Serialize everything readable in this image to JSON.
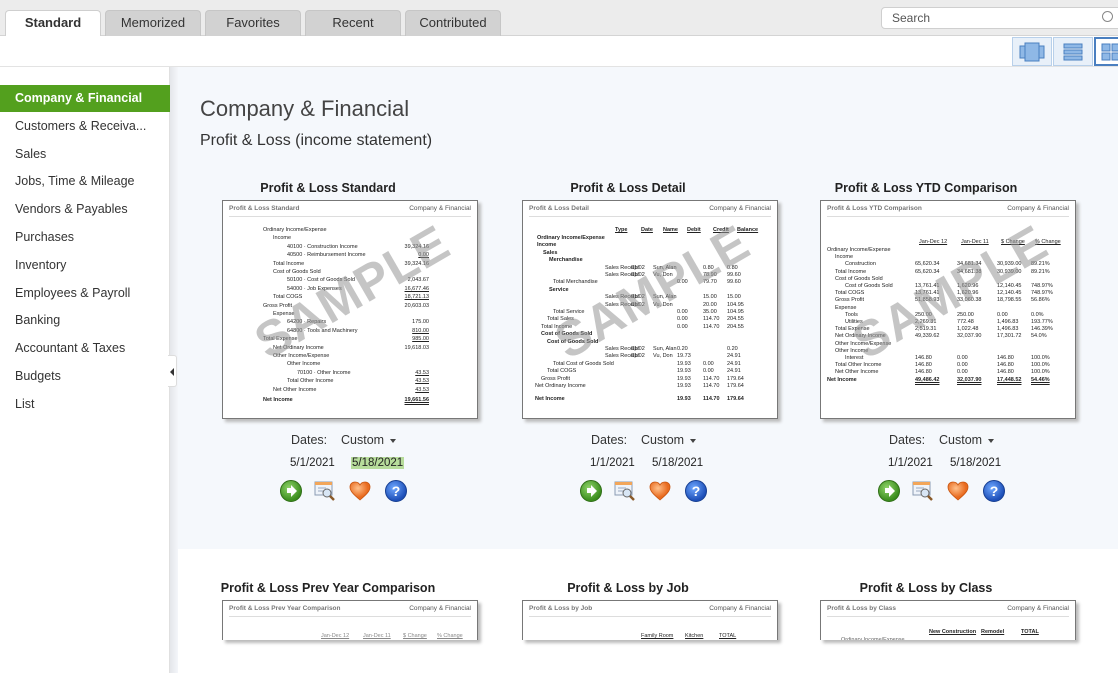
{
  "tabs": [
    {
      "label": "Standard",
      "active": true
    },
    {
      "label": "Memorized"
    },
    {
      "label": "Favorites"
    },
    {
      "label": "Recent"
    },
    {
      "label": "Contributed"
    }
  ],
  "search": {
    "placeholder": "Search"
  },
  "view_toggles": [
    "carousel-view",
    "list-view",
    "grid-view"
  ],
  "sidebar": {
    "items": [
      {
        "label": "Company & Financial",
        "active": true
      },
      {
        "label": "Customers & Receiva..."
      },
      {
        "label": "Sales"
      },
      {
        "label": "Jobs, Time & Mileage"
      },
      {
        "label": "Vendors & Payables"
      },
      {
        "label": "Purchases"
      },
      {
        "label": "Inventory"
      },
      {
        "label": "Employees & Payroll"
      },
      {
        "label": "Banking"
      },
      {
        "label": "Accountant & Taxes"
      },
      {
        "label": "Budgets"
      },
      {
        "label": "List"
      }
    ]
  },
  "main": {
    "title": "Company & Financial",
    "subtitle": "Profit & Loss (income statement)",
    "watermark": "SAMPLE",
    "thumb_category": "Company & Financial",
    "dates_label": "Dates:",
    "help_glyph": "?",
    "reports": [
      {
        "title": "Profit & Loss Standard",
        "thumb_title": "Profit & Loss Standard",
        "dates_preset": "Custom",
        "from": "5/1/2021",
        "to": "5/18/2021",
        "rows": [
          [
            "Ordinary Income/Expense",
            ""
          ],
          [
            "Income",
            ""
          ],
          [
            "40100 · Construction Income",
            "39,324.16"
          ],
          [
            "40500 · Reimbursement Income",
            "0.00"
          ],
          [
            "Total Income",
            "39,324.16"
          ],
          [
            "Cost of Goods Sold",
            ""
          ],
          [
            "50100 · Cost of Goods Sold",
            "2,043.67"
          ],
          [
            "54000 · Job Expenses",
            "16,677.46"
          ],
          [
            "Total COGS",
            "18,721.13"
          ],
          [
            "Gross Profit",
            "20,603.03"
          ],
          [
            "Expense",
            ""
          ],
          [
            "64200 · Repairs",
            "175.00"
          ],
          [
            "64800 · Tools and Machinery",
            "810.00"
          ],
          [
            "Total Expense",
            "985.00"
          ],
          [
            "Net Ordinary Income",
            "19,618.03"
          ],
          [
            "Other Income/Expense",
            ""
          ],
          [
            "Other Income",
            ""
          ],
          [
            "70100 · Other Income",
            "43.53"
          ],
          [
            "Total Other Income",
            "43.53"
          ],
          [
            "Net Other Income",
            "43.53"
          ],
          [
            "Net Income",
            "19,661.56"
          ]
        ]
      },
      {
        "title": "Profit & Loss Detail",
        "thumb_title": "Profit & Loss Detail",
        "dates_preset": "Custom",
        "from": "1/1/2021",
        "to": "5/18/2021",
        "columns": [
          "Type",
          "Date",
          "Name",
          "Debit",
          "Credit",
          "Balance"
        ],
        "rows": [
          [
            "Ordinary Income/Expense",
            "",
            "",
            "",
            "",
            "",
            ""
          ],
          [
            "Income",
            "",
            "",
            "",
            "",
            "",
            ""
          ],
          [
            "Sales",
            "",
            "",
            "",
            "",
            "",
            ""
          ],
          [
            "Merchandise",
            "",
            "",
            "",
            "",
            "",
            ""
          ],
          [
            "",
            "Sales Receipt",
            "01/02",
            "Sun, Alan",
            "",
            "0.80",
            "0.80"
          ],
          [
            "",
            "Sales Receipt",
            "01/02",
            "Vu, Don",
            "",
            "78.90",
            "99.60"
          ],
          [
            "Total Merchandise",
            "",
            "",
            "",
            "0.00",
            "79.70",
            "99.60"
          ],
          [
            "Service",
            "",
            "",
            "",
            "",
            "",
            ""
          ],
          [
            "",
            "Sales Receipt",
            "01/02",
            "Sun, Alan",
            "",
            "15.00",
            "15.00"
          ],
          [
            "",
            "Sales Receipt",
            "01/02",
            "Vu, Don",
            "",
            "20.00",
            "104.95"
          ],
          [
            "Total Service",
            "",
            "",
            "",
            "0.00",
            "35.00",
            "104.95"
          ],
          [
            "Total Sales",
            "",
            "",
            "",
            "0.00",
            "114.70",
            "204.55"
          ],
          [
            "Total Income",
            "",
            "",
            "",
            "0.00",
            "114.70",
            "204.55"
          ],
          [
            "Cost of Goods Sold",
            "",
            "",
            "",
            "",
            "",
            ""
          ],
          [
            "Cost of Goods Sold",
            "",
            "",
            "",
            "",
            "",
            ""
          ],
          [
            "",
            "Sales Receipt",
            "01/02",
            "Sun, Alan",
            "0.20",
            "",
            "0.20"
          ],
          [
            "",
            "Sales Receipt",
            "01/02",
            "Vu, Don",
            "19.73",
            "",
            "24.91"
          ],
          [
            "Total Cost of Goods Sold",
            "",
            "",
            "",
            "19.93",
            "0.00",
            "24.91"
          ],
          [
            "Total COGS",
            "",
            "",
            "",
            "19.93",
            "0.00",
            "24.91"
          ],
          [
            "Gross Profit",
            "",
            "",
            "",
            "19.93",
            "114.70",
            "179.64"
          ],
          [
            "Net Ordinary Income",
            "",
            "",
            "",
            "19.93",
            "114.70",
            "179.64"
          ],
          [
            "Net Income",
            "",
            "",
            "",
            "19.93",
            "114.70",
            "179.64"
          ]
        ]
      },
      {
        "title": "Profit & Loss YTD Comparison",
        "thumb_title": "Profit & Loss YTD Comparison",
        "dates_preset": "Custom",
        "from": "1/1/2021",
        "to": "5/18/2021",
        "columns": [
          "Jan-Dec 12",
          "Jan-Dec 11",
          "$ Change",
          "% Change"
        ],
        "rows": [
          [
            "Ordinary Income/Expense",
            "",
            "",
            "",
            ""
          ],
          [
            "Income",
            "",
            "",
            "",
            ""
          ],
          [
            "Construction",
            "65,620.34",
            "34,681.34",
            "30,939.00",
            "89.21%"
          ],
          [
            "Total Income",
            "65,620.34",
            "34,681.38",
            "30,939.00",
            "89.21%"
          ],
          [
            "Cost of Goods Sold",
            "",
            "",
            "",
            ""
          ],
          [
            "Cost of Goods Sold",
            "13,761.41",
            "1,620.96",
            "12,140.45",
            "748.97%"
          ],
          [
            "Total COGS",
            "13,761.41",
            "1,620.96",
            "12,140.45",
            "748.97%"
          ],
          [
            "Gross Profit",
            "51,858.93",
            "33,060.38",
            "18,798.55",
            "56.86%"
          ],
          [
            "Expense",
            "",
            "",
            "",
            ""
          ],
          [
            "Tools",
            "250.00",
            "250.00",
            "0.00",
            "0.0%"
          ],
          [
            "Utilities",
            "2,269.31",
            "772.48",
            "1,496.83",
            "193.77%"
          ],
          [
            "Total Expense",
            "2,519.31",
            "1,022.48",
            "1,496.83",
            "146.39%"
          ],
          [
            "Net Ordinary Income",
            "49,339.62",
            "32,037.90",
            "17,301.72",
            "54.0%"
          ],
          [
            "Other Income/Expense",
            "",
            "",
            "",
            ""
          ],
          [
            "Other Income",
            "",
            "",
            "",
            ""
          ],
          [
            "Interest",
            "146.80",
            "0.00",
            "146.80",
            "100.0%"
          ],
          [
            "Total Other Income",
            "146.80",
            "0.00",
            "146.80",
            "100.0%"
          ],
          [
            "Net Other Income",
            "146.80",
            "0.00",
            "146.80",
            "100.0%"
          ],
          [
            "Net Income",
            "49,486.42",
            "32,037.90",
            "17,448.52",
            "54.46%"
          ]
        ]
      },
      {
        "title": "Profit & Loss Prev Year Comparison",
        "thumb_title": "Profit & Loss Prev Year Comparison",
        "columns": [
          "Jan-Dec 12",
          "Jan-Dec 11",
          "$ Change",
          "% Change"
        ]
      },
      {
        "title": "Profit & Loss by Job",
        "thumb_title": "Profit & Loss by Job",
        "columns": [
          "Family Room",
          "Kitchen",
          "TOTAL"
        ]
      },
      {
        "title": "Profit & Loss by Class",
        "thumb_title": "Profit & Loss by Class",
        "columns": [
          "New Construction",
          "Remodel",
          "TOTAL"
        ],
        "first_row": "Ordinary Income/Expense"
      }
    ]
  }
}
